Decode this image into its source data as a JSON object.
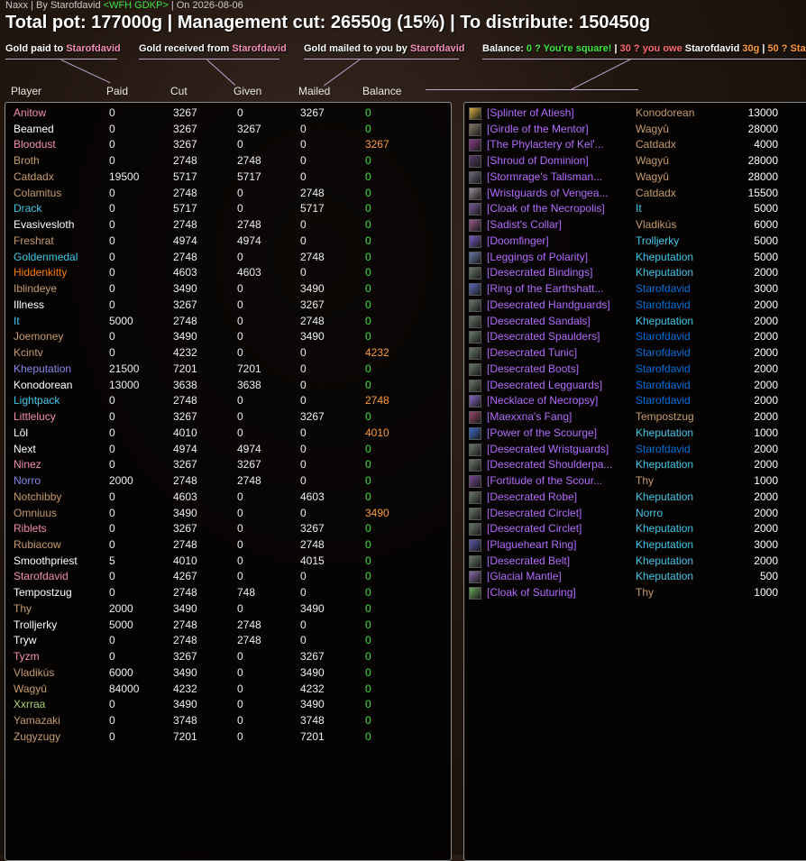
{
  "header": {
    "raid": "Naxx",
    "by_prefix": " | By ",
    "author": "Starofdavid",
    "guild": "<WFH GDKP>",
    "date_prefix": " | On ",
    "date": "2026-08-06",
    "title": "Total pot: 177000g | Management cut: 26550g (15%) | To distribute: 150450g"
  },
  "legend": {
    "paid_label": "Gold paid to ",
    "paid_name": "Starofdavid",
    "received_label": "Gold received from ",
    "received_name": "Starofdavid",
    "mailed_label": "Gold mailed to you by ",
    "mailed_name": "Starofdavid",
    "balance_label": "Balance: ",
    "balance_ok": "0 ? You're square!",
    "sep1": " | ",
    "balance_owe_a": "30 ? you owe ",
    "balance_owe_name": "Starofdavid",
    "balance_owe_b": " 30g",
    "sep2": " | ",
    "balance_more": "50 ? Sta"
  },
  "columns": [
    "Player",
    "Paid",
    "Cut",
    "Given",
    "Mailed",
    "Balance"
  ],
  "colors": {
    "druid": "#ff7c0a",
    "hunter": "#aad372",
    "mage": "#3fc7eb",
    "paladin": "#f48cba",
    "priest": "#ffffff",
    "rogue": "#fff468",
    "shaman": "#0070dd",
    "warlock": "#8788ee",
    "warrior": "#c69b6d",
    "item": "#a335ee",
    "balance_zero": "#3ee63e",
    "balance_pos": "#ff9a3c"
  },
  "players": [
    {
      "name": "Anitow",
      "cls": "paladin",
      "paid": "0",
      "cut": "3267",
      "given": "0",
      "mailed": "3267",
      "balance": "0"
    },
    {
      "name": "Beamed",
      "cls": "priest",
      "paid": "0",
      "cut": "3267",
      "given": "3267",
      "mailed": "0",
      "balance": "0"
    },
    {
      "name": "Bloodust",
      "cls": "paladin",
      "paid": "0",
      "cut": "3267",
      "given": "0",
      "mailed": "0",
      "balance": "3267"
    },
    {
      "name": "Broth",
      "cls": "warrior",
      "paid": "0",
      "cut": "2748",
      "given": "2748",
      "mailed": "0",
      "balance": "0"
    },
    {
      "name": "Catdadx",
      "cls": "warrior",
      "paid": "19500",
      "cut": "5717",
      "given": "5717",
      "mailed": "0",
      "balance": "0"
    },
    {
      "name": "Colamitus",
      "cls": "warrior",
      "paid": "0",
      "cut": "2748",
      "given": "0",
      "mailed": "2748",
      "balance": "0"
    },
    {
      "name": "Drack",
      "cls": "mage",
      "paid": "0",
      "cut": "5717",
      "given": "0",
      "mailed": "5717",
      "balance": "0"
    },
    {
      "name": "Evasivesloth",
      "cls": "priest",
      "paid": "0",
      "cut": "2748",
      "given": "2748",
      "mailed": "0",
      "balance": "0"
    },
    {
      "name": "Freshrat",
      "cls": "warrior",
      "paid": "0",
      "cut": "4974",
      "given": "4974",
      "mailed": "0",
      "balance": "0"
    },
    {
      "name": "Goldenmedal",
      "cls": "mage",
      "paid": "0",
      "cut": "2748",
      "given": "0",
      "mailed": "2748",
      "balance": "0"
    },
    {
      "name": "Hiddenkitty",
      "cls": "druid",
      "paid": "0",
      "cut": "4603",
      "given": "4603",
      "mailed": "0",
      "balance": "0"
    },
    {
      "name": "Iblindeye",
      "cls": "warrior",
      "paid": "0",
      "cut": "3490",
      "given": "0",
      "mailed": "3490",
      "balance": "0"
    },
    {
      "name": "Illness",
      "cls": "priest",
      "paid": "0",
      "cut": "3267",
      "given": "0",
      "mailed": "3267",
      "balance": "0"
    },
    {
      "name": "It",
      "cls": "mage",
      "paid": "5000",
      "cut": "2748",
      "given": "0",
      "mailed": "2748",
      "balance": "0"
    },
    {
      "name": "Joemoney",
      "cls": "warrior",
      "paid": "0",
      "cut": "3490",
      "given": "0",
      "mailed": "3490",
      "balance": "0"
    },
    {
      "name": "Kcintv",
      "cls": "warrior",
      "paid": "0",
      "cut": "4232",
      "given": "0",
      "mailed": "0",
      "balance": "4232"
    },
    {
      "name": "Kheputation",
      "cls": "warlock",
      "paid": "21500",
      "cut": "7201",
      "given": "7201",
      "mailed": "0",
      "balance": "0"
    },
    {
      "name": "Konodorean",
      "cls": "priest",
      "paid": "13000",
      "cut": "3638",
      "given": "3638",
      "mailed": "0",
      "balance": "0"
    },
    {
      "name": "Lightpack",
      "cls": "mage",
      "paid": "0",
      "cut": "2748",
      "given": "0",
      "mailed": "0",
      "balance": "2748"
    },
    {
      "name": "Littlelucy",
      "cls": "paladin",
      "paid": "0",
      "cut": "3267",
      "given": "0",
      "mailed": "3267",
      "balance": "0"
    },
    {
      "name": "Lôl",
      "cls": "priest",
      "paid": "0",
      "cut": "4010",
      "given": "0",
      "mailed": "0",
      "balance": "4010"
    },
    {
      "name": "Next",
      "cls": "priest",
      "paid": "0",
      "cut": "4974",
      "given": "4974",
      "mailed": "0",
      "balance": "0"
    },
    {
      "name": "Ninez",
      "cls": "paladin",
      "paid": "0",
      "cut": "3267",
      "given": "3267",
      "mailed": "0",
      "balance": "0"
    },
    {
      "name": "Norro",
      "cls": "warlock",
      "paid": "2000",
      "cut": "2748",
      "given": "2748",
      "mailed": "0",
      "balance": "0"
    },
    {
      "name": "Notchibby",
      "cls": "warrior",
      "paid": "0",
      "cut": "4603",
      "given": "0",
      "mailed": "4603",
      "balance": "0"
    },
    {
      "name": "Omniuus",
      "cls": "warrior",
      "paid": "0",
      "cut": "3490",
      "given": "0",
      "mailed": "0",
      "balance": "3490"
    },
    {
      "name": "Riblets",
      "cls": "paladin",
      "paid": "0",
      "cut": "3267",
      "given": "0",
      "mailed": "3267",
      "balance": "0"
    },
    {
      "name": "Rubiacow",
      "cls": "warrior",
      "paid": "0",
      "cut": "2748",
      "given": "0",
      "mailed": "2748",
      "balance": "0"
    },
    {
      "name": "Smoothpriest",
      "cls": "priest",
      "paid": "5",
      "cut": "4010",
      "given": "0",
      "mailed": "4015",
      "balance": "0"
    },
    {
      "name": "Starofdavid",
      "cls": "paladin",
      "paid": "0",
      "cut": "4267",
      "given": "0",
      "mailed": "0",
      "balance": "0"
    },
    {
      "name": "Tempostzug",
      "cls": "priest",
      "paid": "0",
      "cut": "2748",
      "given": "748",
      "mailed": "0",
      "balance": "0"
    },
    {
      "name": "Thy",
      "cls": "warrior",
      "paid": "2000",
      "cut": "3490",
      "given": "0",
      "mailed": "3490",
      "balance": "0"
    },
    {
      "name": "Trolljerky",
      "cls": "priest",
      "paid": "5000",
      "cut": "2748",
      "given": "2748",
      "mailed": "0",
      "balance": "0"
    },
    {
      "name": "Tryw",
      "cls": "priest",
      "paid": "0",
      "cut": "2748",
      "given": "2748",
      "mailed": "0",
      "balance": "0"
    },
    {
      "name": "Tyzm",
      "cls": "paladin",
      "paid": "0",
      "cut": "3267",
      "given": "0",
      "mailed": "3267",
      "balance": "0"
    },
    {
      "name": "Vladikús",
      "cls": "warrior",
      "paid": "6000",
      "cut": "3490",
      "given": "0",
      "mailed": "3490",
      "balance": "0"
    },
    {
      "name": "Wagyû",
      "cls": "warrior",
      "paid": "84000",
      "cut": "4232",
      "given": "0",
      "mailed": "4232",
      "balance": "0"
    },
    {
      "name": "Xxrraa",
      "cls": "hunter",
      "paid": "0",
      "cut": "3490",
      "given": "0",
      "mailed": "3490",
      "balance": "0"
    },
    {
      "name": "Yamazaki",
      "cls": "warrior",
      "paid": "0",
      "cut": "3748",
      "given": "0",
      "mailed": "3748",
      "balance": "0"
    },
    {
      "name": "Zugyzugy",
      "cls": "warrior",
      "paid": "0",
      "cut": "7201",
      "given": "0",
      "mailed": "7201",
      "balance": "0"
    }
  ],
  "items": [
    {
      "icon": "sword-icon",
      "icon_color": "#d8b040",
      "name": "[Splinter of Atiesh]",
      "winner": "Konodorean",
      "cls": "warrior",
      "price": "13000"
    },
    {
      "icon": "belt-icon",
      "icon_color": "#8a7a66",
      "name": "[Girdle of the Mentor]",
      "winner": "Wagyû",
      "cls": "warrior",
      "price": "28000"
    },
    {
      "icon": "phylactery-icon",
      "icon_color": "#8a3a8a",
      "name": "[The Phylactery of Kel'...",
      "winner": "Catdadx",
      "cls": "warrior",
      "price": "4000"
    },
    {
      "icon": "shroud-icon",
      "icon_color": "#5a3a6a",
      "name": "[Shroud of Dominion]",
      "winner": "Wagyû",
      "cls": "warrior",
      "price": "28000"
    },
    {
      "icon": "talisman-icon",
      "icon_color": "#6a6a7a",
      "name": "[Stormrage's Talisman...",
      "winner": "Wagyû",
      "cls": "warrior",
      "price": "28000"
    },
    {
      "icon": "wristguard-icon",
      "icon_color": "#9a8a9a",
      "name": "[Wristguards of Vengea...",
      "winner": "Catdadx",
      "cls": "warrior",
      "price": "15500"
    },
    {
      "icon": "cloak-icon",
      "icon_color": "#7a5a9a",
      "name": "[Cloak of the Necropolis]",
      "winner": "It",
      "cls": "mage",
      "price": "5000"
    },
    {
      "icon": "collar-icon",
      "icon_color": "#9a5a8a",
      "name": "[Sadist's Collar]",
      "winner": "Vladikús",
      "cls": "warrior",
      "price": "6000"
    },
    {
      "icon": "ring-icon",
      "icon_color": "#7a5aca",
      "name": "[Doomfinger]",
      "winner": "Trolljerky",
      "cls": "mage",
      "price": "5000"
    },
    {
      "icon": "leggings-icon",
      "icon_color": "#6a7aaa",
      "name": "[Leggings of Polarity]",
      "winner": "Kheputation",
      "cls": "mage",
      "price": "5000"
    },
    {
      "icon": "bracer-icon",
      "icon_color": "#6a7a6a",
      "name": "[Desecrated Bindings]",
      "winner": "Kheputation",
      "cls": "mage",
      "price": "2000"
    },
    {
      "icon": "ring-icon",
      "icon_color": "#5a6aba",
      "name": "[Ring of the Earthshatt...",
      "winner": "Starofdavid",
      "cls": "shaman",
      "price": "3000"
    },
    {
      "icon": "glove-icon",
      "icon_color": "#6a7a6a",
      "name": "[Desecrated Handguards]",
      "winner": "Starofdavid",
      "cls": "shaman",
      "price": "2000"
    },
    {
      "icon": "boot-icon",
      "icon_color": "#6a7a6a",
      "name": "[Desecrated Sandals]",
      "winner": "Kheputation",
      "cls": "mage",
      "price": "2000"
    },
    {
      "icon": "shoulder-icon",
      "icon_color": "#6a7a6a",
      "name": "[Desecrated Spaulders]",
      "winner": "Starofdavid",
      "cls": "shaman",
      "price": "2000"
    },
    {
      "icon": "chest-icon",
      "icon_color": "#6a7a6a",
      "name": "[Desecrated Tunic]",
      "winner": "Starofdavid",
      "cls": "shaman",
      "price": "2000"
    },
    {
      "icon": "boot-icon",
      "icon_color": "#6a7a6a",
      "name": "[Desecrated Boots]",
      "winner": "Starofdavid",
      "cls": "shaman",
      "price": "2000"
    },
    {
      "icon": "leggings-icon",
      "icon_color": "#6a7a6a",
      "name": "[Desecrated Legguards]",
      "winner": "Starofdavid",
      "cls": "shaman",
      "price": "2000"
    },
    {
      "icon": "necklace-icon",
      "icon_color": "#8a6aca",
      "name": "[Necklace of Necropsy]",
      "winner": "Starofdavid",
      "cls": "shaman",
      "price": "2000"
    },
    {
      "icon": "fang-icon",
      "icon_color": "#9a4a6a",
      "name": "[Maexxna's Fang]",
      "winner": "Tempostzug",
      "cls": "warrior",
      "price": "2000"
    },
    {
      "icon": "orb-icon",
      "icon_color": "#3a6aca",
      "name": "[Power of the Scourge]",
      "winner": "Kheputation",
      "cls": "mage",
      "price": "1000"
    },
    {
      "icon": "bracer-icon",
      "icon_color": "#6a7a6a",
      "name": "[Desecrated Wristguards]",
      "winner": "Starofdavid",
      "cls": "shaman",
      "price": "2000"
    },
    {
      "icon": "shoulder-icon",
      "icon_color": "#6a7a6a",
      "name": "[Desecrated Shoulderpa...",
      "winner": "Kheputation",
      "cls": "mage",
      "price": "2000"
    },
    {
      "icon": "scroll-icon",
      "icon_color": "#7a4a9a",
      "name": "[Fortitude of the Scour...",
      "winner": "Thy",
      "cls": "warrior",
      "price": "1000"
    },
    {
      "icon": "robe-icon",
      "icon_color": "#6a7a6a",
      "name": "[Desecrated Robe]",
      "winner": "Kheputation",
      "cls": "mage",
      "price": "2000"
    },
    {
      "icon": "helm-icon",
      "icon_color": "#6a7a6a",
      "name": "[Desecrated Circlet]",
      "winner": "Norro",
      "cls": "mage",
      "price": "2000"
    },
    {
      "icon": "helm-icon",
      "icon_color": "#6a7a6a",
      "name": "[Desecrated Circlet]",
      "winner": "Kheputation",
      "cls": "mage",
      "price": "2000"
    },
    {
      "icon": "ring-icon",
      "icon_color": "#5a5aaa",
      "name": "[Plagueheart Ring]",
      "winner": "Kheputation",
      "cls": "mage",
      "price": "3000"
    },
    {
      "icon": "belt-icon",
      "icon_color": "#6a7a6a",
      "name": "[Desecrated Belt]",
      "winner": "Kheputation",
      "cls": "mage",
      "price": "2000"
    },
    {
      "icon": "mantle-icon",
      "icon_color": "#8a6aaa",
      "name": "[Glacial Mantle]",
      "winner": "Kheputation",
      "cls": "mage",
      "price": "500"
    },
    {
      "icon": "cloak-icon",
      "icon_color": "#6aaa5a",
      "name": "[Cloak of Suturing]",
      "winner": "Thy",
      "cls": "warrior",
      "price": "1000"
    }
  ]
}
